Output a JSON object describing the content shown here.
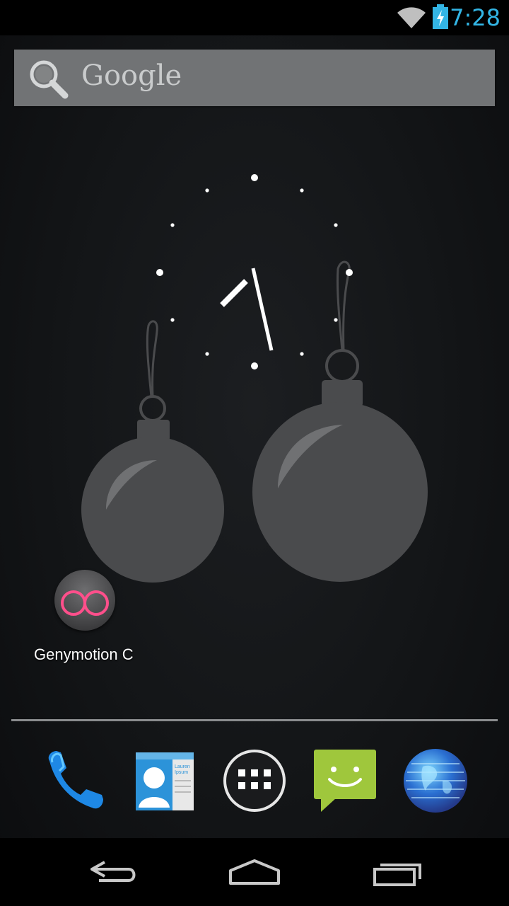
{
  "status_bar": {
    "time": "7:28",
    "icons": [
      "wifi-icon",
      "battery-charging-icon"
    ],
    "accent_color": "#33b5e5"
  },
  "search": {
    "label": "Google",
    "icon": "search-icon"
  },
  "clock": {
    "type": "analog",
    "hour_hand_angle_deg": -135,
    "minute_hand_angle_deg": 168
  },
  "home_shortcuts": [
    {
      "label": "Genymotion C",
      "icon": "genymotion-icon"
    }
  ],
  "dock": [
    {
      "name": "phone",
      "icon": "phone-icon"
    },
    {
      "name": "contacts",
      "icon": "contacts-icon",
      "card_text": "Lauren Ipsum"
    },
    {
      "name": "all-apps",
      "icon": "all-apps-icon"
    },
    {
      "name": "messaging",
      "icon": "messaging-icon"
    },
    {
      "name": "browser",
      "icon": "browser-globe-icon"
    }
  ],
  "nav_bar": {
    "buttons": [
      "back-icon",
      "home-icon",
      "recent-apps-icon"
    ]
  }
}
